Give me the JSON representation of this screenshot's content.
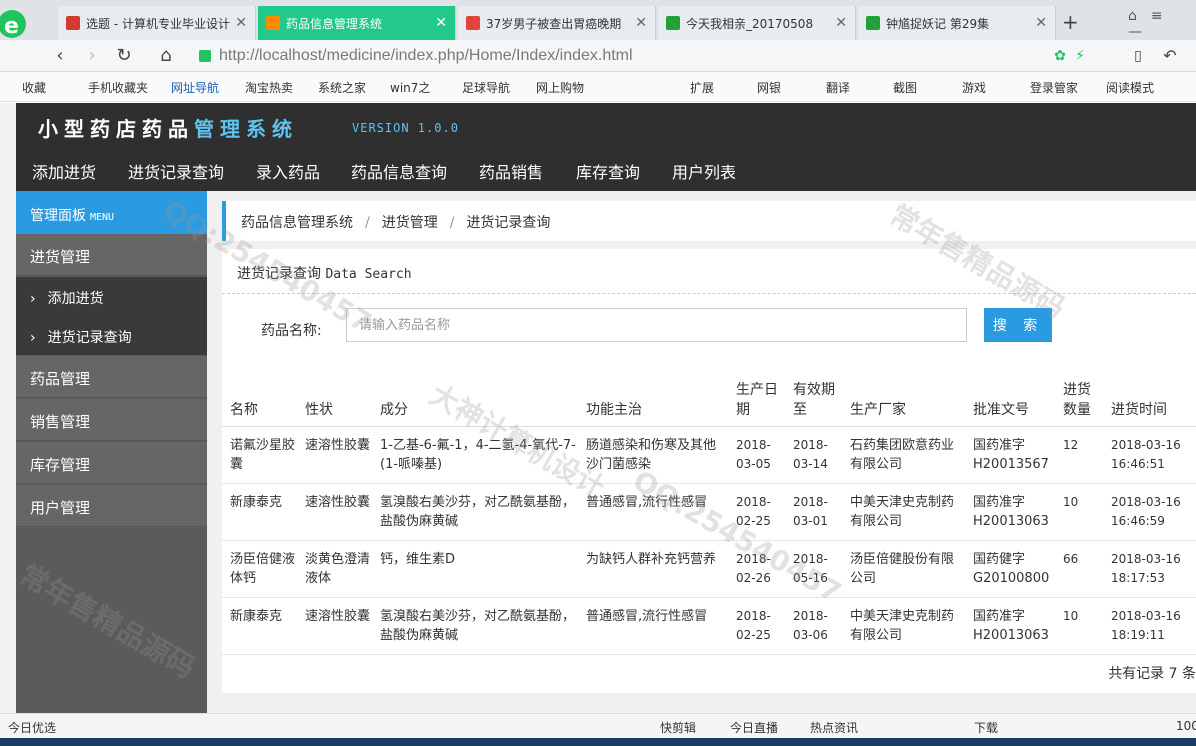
{
  "browser": {
    "tabs": [
      {
        "label": "选题 - 计算机专业毕业设计",
        "color": "#d23b2e"
      },
      {
        "label": "药品信息管理系统",
        "color": "#ff8a00"
      },
      {
        "label": "37岁男子被查出胃癌晚期",
        "color": "#e0443a"
      },
      {
        "label": "今天我相亲_20170508",
        "color": "#22a03a"
      },
      {
        "label": "钟馗捉妖记 第29集",
        "color": "#22a03a"
      }
    ],
    "new_tab": "+",
    "url": "http://localhost/medicine/index.php/Home/Index/index.html",
    "bookmarks": [
      "收藏",
      "手机收藏夹",
      "网址导航",
      "淘宝热卖",
      "系统之家",
      "win7之",
      "足球导航",
      "网上购物",
      "扩展",
      "网银",
      "翻译",
      "截图",
      "游戏",
      "登录管家",
      "阅读模式"
    ]
  },
  "app": {
    "logo_main": "小型药店药品",
    "logo_accent": "管理系统",
    "version": "VERSION 1.0.0",
    "top_nav": [
      "添加进货",
      "进货记录查询",
      "录入药品",
      "药品信息查询",
      "药品销售",
      "库存查询",
      "用户列表"
    ]
  },
  "sidebar": {
    "head": "管理面板",
    "head_en": "MENU",
    "group": "进货管理",
    "sub_items": [
      "添加进货",
      "进货记录查询"
    ],
    "menus": [
      "药品管理",
      "销售管理",
      "库存管理",
      "用户管理"
    ]
  },
  "breadcrumb": [
    "药品信息管理系统",
    "进货管理",
    "进货记录查询"
  ],
  "panel": {
    "title": "进货记录查询",
    "title_en": "Data Search",
    "search_label": "药品名称:",
    "search_placeholder": "请输入药品名称",
    "search_button": "搜 索"
  },
  "table": {
    "headers": [
      "名称",
      "性状",
      "成分",
      "功能主治",
      "生产日期",
      "有效期至",
      "生产厂家",
      "批准文号",
      "进货数量",
      "进货时间"
    ],
    "rows": [
      [
        "诺氟沙星胶囊",
        "速溶性胶囊",
        "1-乙基-6-氟-1，4-二氢-4-氧代-7-(1-哌嗪基)",
        "肠道感染和伤寒及其他沙门菌感染",
        "2018-03-05",
        "2018-03-14",
        "石药集团欧意药业有限公司",
        "国药准字H20013567",
        "12",
        "2018-03-16 16:46:51"
      ],
      [
        "新康泰克",
        "速溶性胶囊",
        "氢溴酸右美沙芬，对乙酰氨基酚，盐酸伪麻黄碱",
        "普通感冒,流行性感冒",
        "2018-02-25",
        "2018-03-01",
        "中美天津史克制药有限公司",
        "国药准字H20013063",
        "10",
        "2018-03-16 16:46:59"
      ],
      [
        "汤臣倍健液体钙",
        "淡黄色澄清液体",
        "钙，维生素D",
        "为缺钙人群补充钙营养",
        "2018-02-26",
        "2018-05-16",
        "汤臣倍健股份有限公司",
        "国药健字G20100800",
        "66",
        "2018-03-16 18:17:53"
      ],
      [
        "新康泰克",
        "速溶性胶囊",
        "氢溴酸右美沙芬，对乙酰氨基酚，盐酸伪麻黄碱",
        "普通感冒,流行性感冒",
        "2018-02-25",
        "2018-03-06",
        "中美天津史克制药有限公司",
        "国药准字H20013063",
        "10",
        "2018-03-16 18:19:11"
      ]
    ],
    "total": "共有记录 7 条"
  },
  "watermarks": [
    "QQ:254540457",
    "常年售精品源码",
    "大神计算机设计"
  ],
  "statusbar": {
    "left": "今日优选",
    "items": [
      "快剪辑",
      "今日直播",
      "热点资讯",
      "下载",
      "100"
    ]
  }
}
